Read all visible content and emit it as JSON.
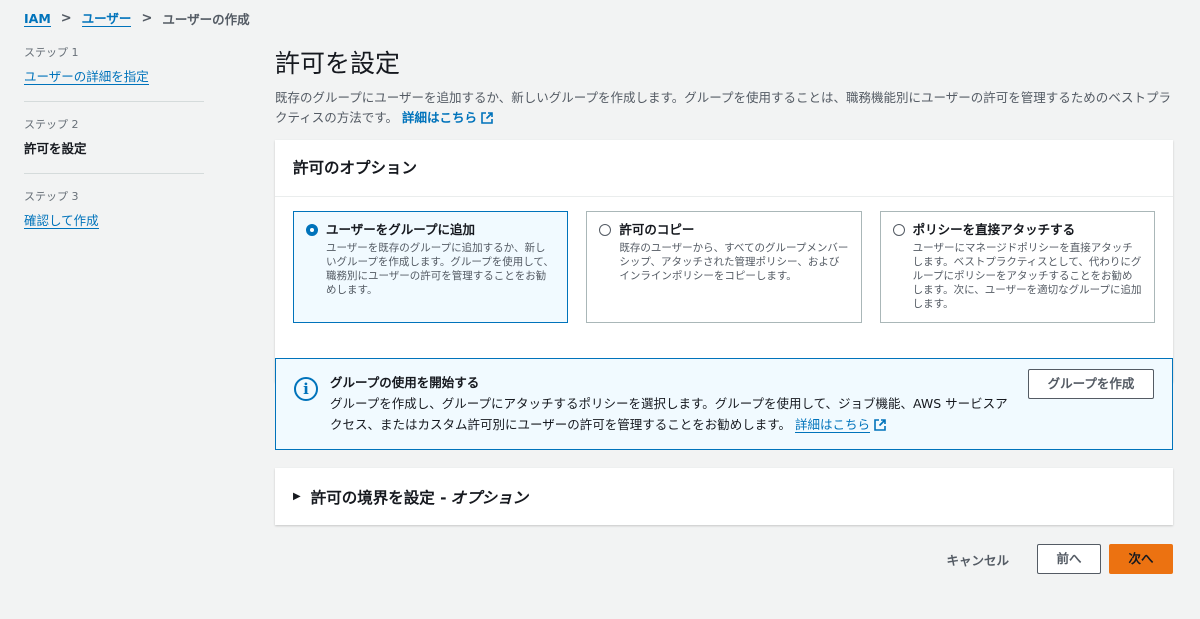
{
  "breadcrumb": {
    "items": [
      "IAM",
      "ユーザー"
    ],
    "current": "ユーザーの作成",
    "separator": ">"
  },
  "steps": [
    {
      "number": "ステップ 1",
      "label": "ユーザーの詳細を指定"
    },
    {
      "number": "ステップ 2",
      "label": "許可を設定"
    },
    {
      "number": "ステップ 3",
      "label": "確認して作成"
    }
  ],
  "page": {
    "title": "許可を設定",
    "description": "既存のグループにユーザーを追加するか、新しいグループを作成します。グループを使用することは、職務機能別にユーザーの許可を管理するためのベストプラクティスの方法です。",
    "learn_more": "詳細はこちら"
  },
  "options_panel": {
    "title": "許可のオプション",
    "options": [
      {
        "title": "ユーザーをグループに追加",
        "desc": "ユーザーを既存のグループに追加するか、新しいグループを作成します。グループを使用して、職務別にユーザーの許可を管理することをお勧めします。",
        "selected": true
      },
      {
        "title": "許可のコピー",
        "desc": "既存のユーザーから、すべてのグループメンバーシップ、アタッチされた管理ポリシー、およびインラインポリシーをコピーします。",
        "selected": false
      },
      {
        "title": "ポリシーを直接アタッチする",
        "desc": "ユーザーにマネージドポリシーを直接アタッチします。ベストプラクティスとして、代わりにグループにポリシーをアタッチすることをお勧めします。次に、ユーザーを適切なグループに追加します。",
        "selected": false
      }
    ]
  },
  "info": {
    "title": "グループの使用を開始する",
    "desc": "グループを作成し、グループにアタッチするポリシーを選択します。グループを使用して、ジョブ機能、AWS サービスアクセス、またはカスタム許可別にユーザーの許可を管理することをお勧めします。",
    "learn_more": "詳細はこちら",
    "button": "グループを作成",
    "icon": "info-icon"
  },
  "boundary": {
    "title": "許可の境界を設定 - ",
    "title_italic": "オプション"
  },
  "footer": {
    "cancel": "キャンセル",
    "prev": "前へ",
    "next": "次へ"
  },
  "colors": {
    "link": "#0073bb",
    "primary": "#ec7211",
    "background": "#f2f3f3"
  }
}
